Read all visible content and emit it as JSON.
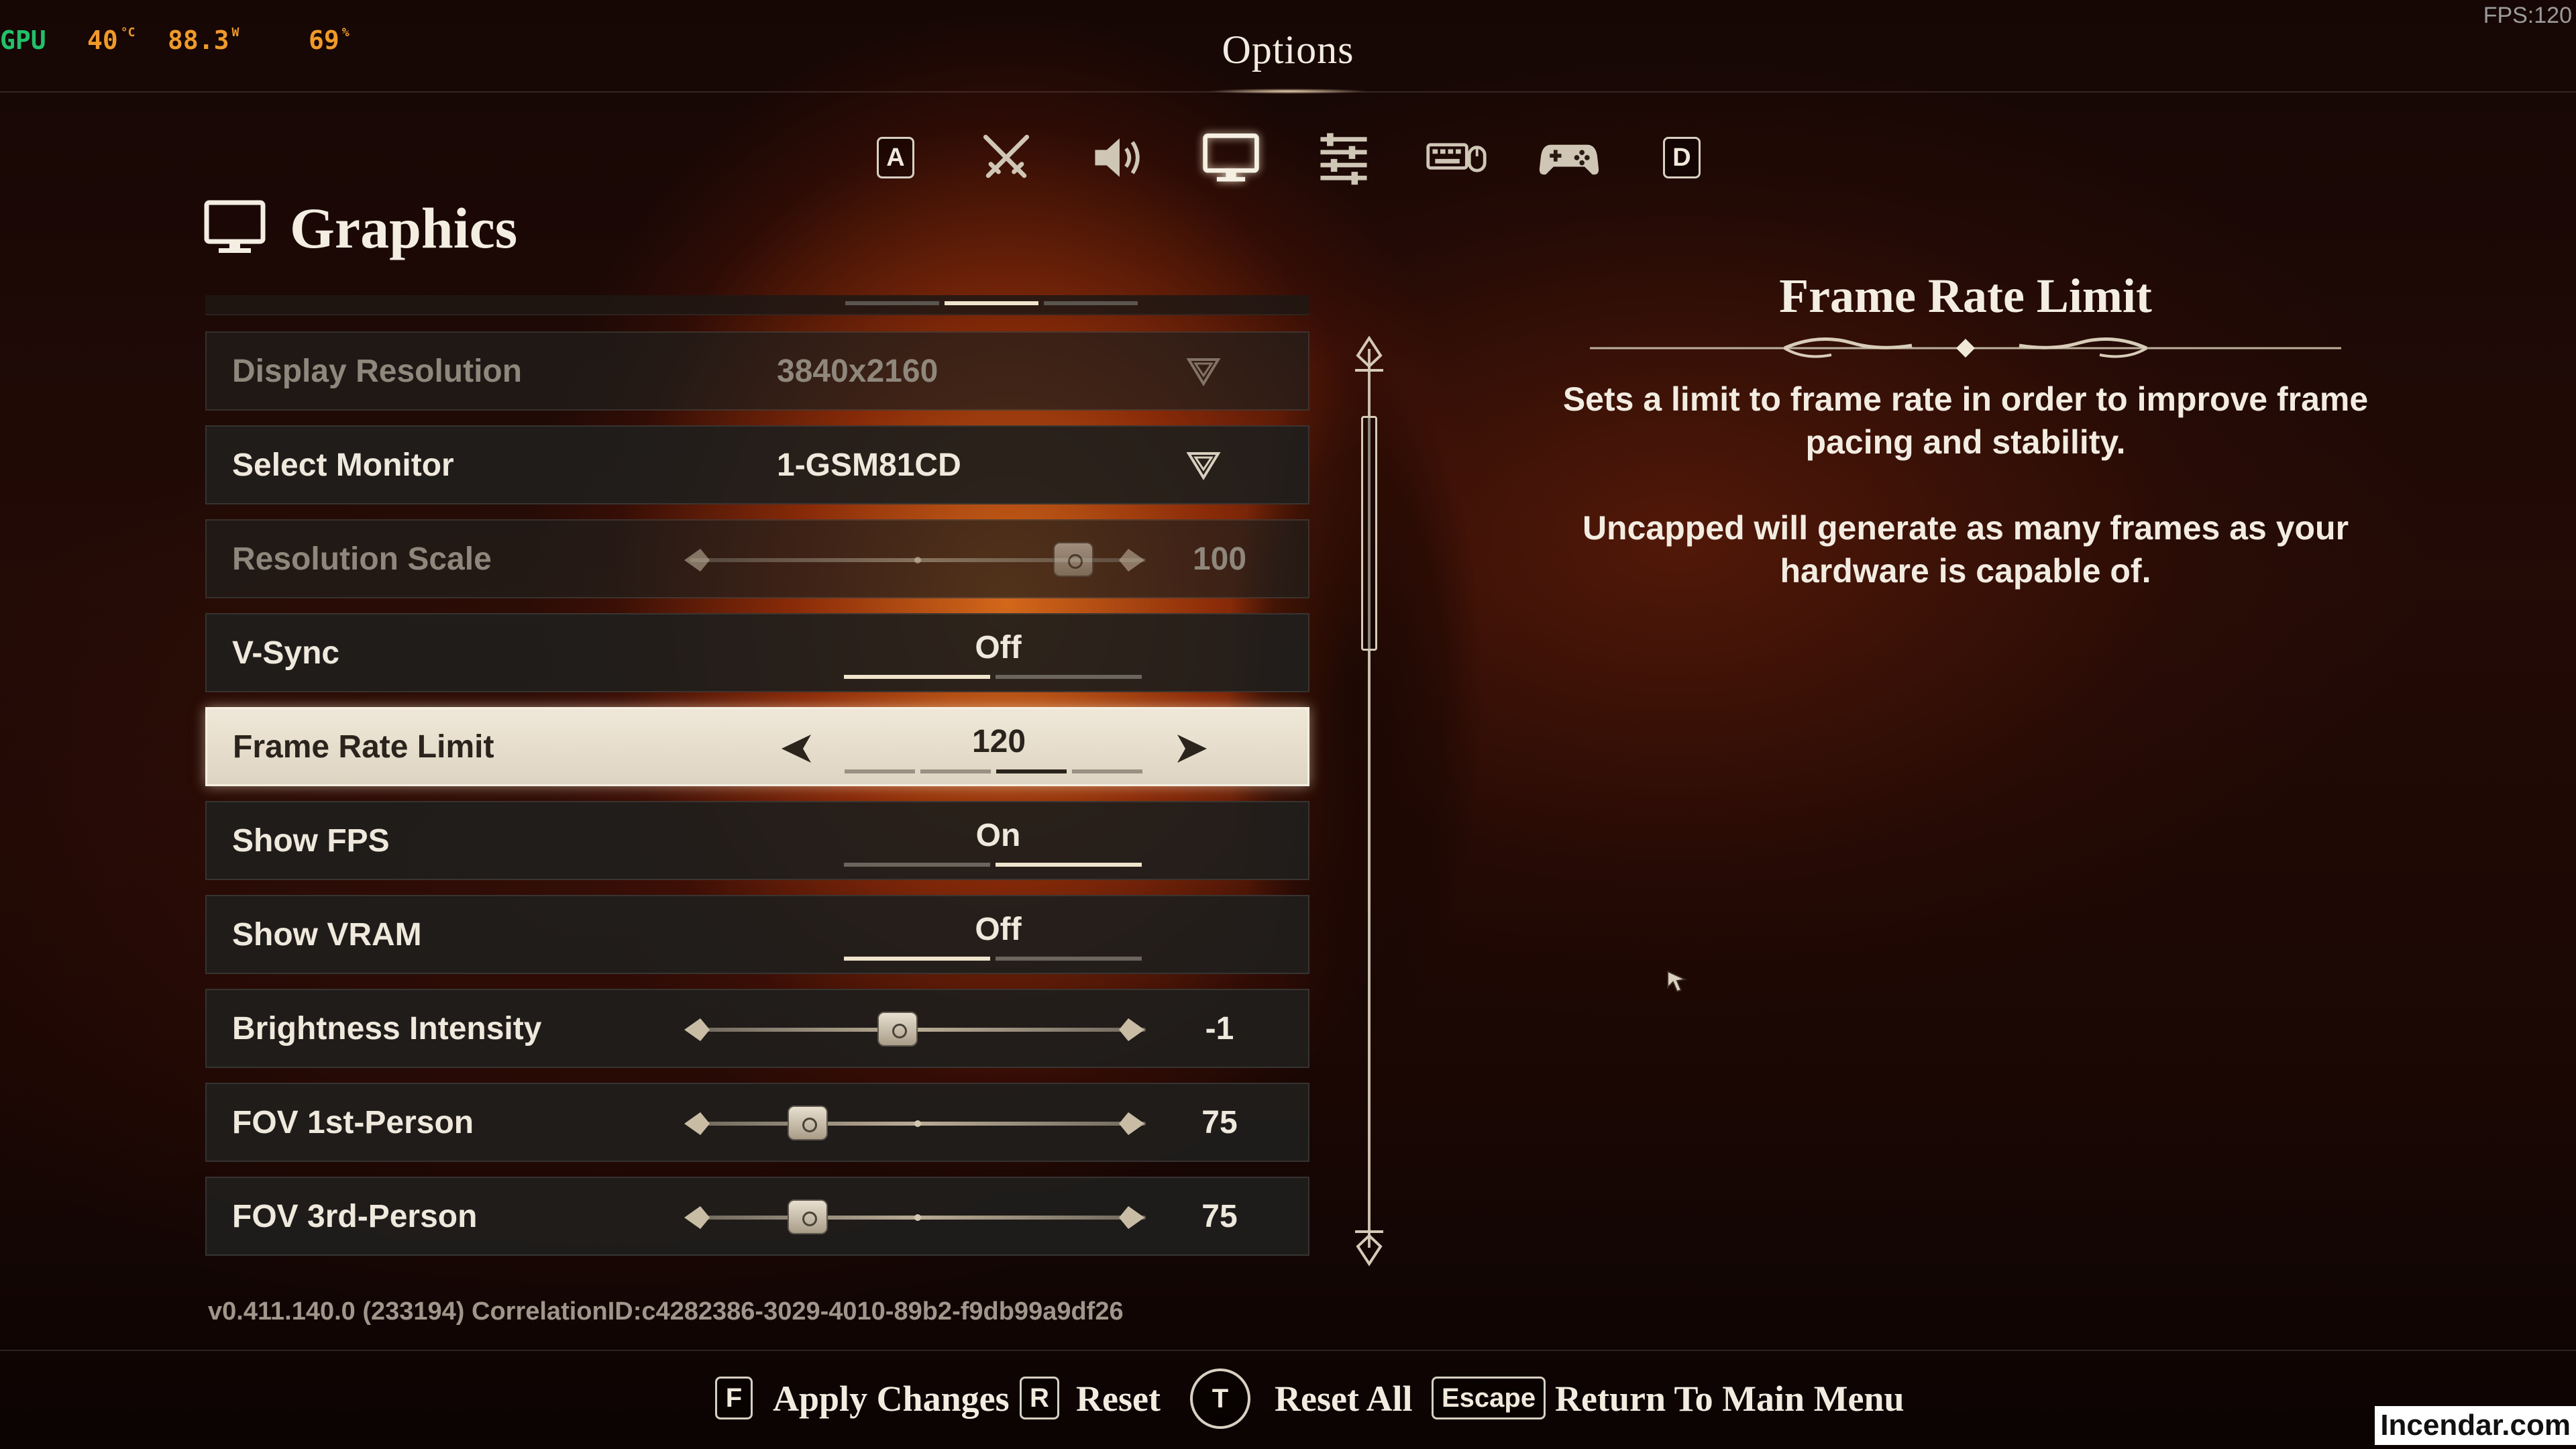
{
  "hud": {
    "gpu_label": "GPU",
    "temp": "40",
    "temp_unit": "°C",
    "power": "88.3",
    "power_unit": "W",
    "usage": "69",
    "usage_unit": "%",
    "fps": "FPS:120"
  },
  "header": {
    "title": "Options"
  },
  "tabs": [
    {
      "label": "A",
      "icon": "keycap-a-icon",
      "kind": "key"
    },
    {
      "label": "",
      "icon": "crossed-swords-icon",
      "kind": "icon"
    },
    {
      "label": "",
      "icon": "speaker-icon",
      "kind": "icon"
    },
    {
      "label": "",
      "icon": "monitor-icon",
      "kind": "icon",
      "active": true
    },
    {
      "label": "",
      "icon": "sliders-icon",
      "kind": "icon"
    },
    {
      "label": "",
      "icon": "keyboard-mouse-icon",
      "kind": "icon"
    },
    {
      "label": "",
      "icon": "gamepad-icon",
      "kind": "icon"
    },
    {
      "label": "D",
      "icon": "keycap-d-icon",
      "kind": "key"
    }
  ],
  "section": {
    "title": "Graphics",
    "icon": "monitor-icon"
  },
  "pagination": {
    "pages": 3,
    "current": 2
  },
  "settings": [
    {
      "label": "Display Resolution",
      "type": "dropdown",
      "value": "3840x2160",
      "disabled": true
    },
    {
      "label": "Select Monitor",
      "type": "dropdown",
      "value": "1-GSM81CD"
    },
    {
      "label": "Resolution Scale",
      "type": "slider",
      "value": "100",
      "level": 1.0,
      "disabled": true
    },
    {
      "label": "V-Sync",
      "type": "toggle",
      "value": "Off",
      "segments": 2,
      "active_segment": 1
    },
    {
      "label": "Frame Rate Limit",
      "type": "selector",
      "value": "120",
      "segments": 4,
      "active_segment": 3,
      "selected": true
    },
    {
      "label": "Show FPS",
      "type": "toggle",
      "value": "On",
      "segments": 2,
      "active_segment": 2
    },
    {
      "label": "Show VRAM",
      "type": "toggle",
      "value": "Off",
      "segments": 2,
      "active_segment": 1
    },
    {
      "label": "Brightness Intensity",
      "type": "slider",
      "value": "-1",
      "level": 0.45
    },
    {
      "label": "FOV 1st-Person",
      "type": "slider",
      "value": "75",
      "level": 0.25
    },
    {
      "label": "FOV 3rd-Person",
      "type": "slider",
      "value": "75",
      "level": 0.25
    }
  ],
  "description": {
    "title": "Frame Rate Limit",
    "text1": "Sets a limit to frame rate in order to improve frame pacing and stability.",
    "text2": "Uncapped will generate as many frames as your hardware is capable of."
  },
  "version": "v0.411.140.0 (233194) CorrelationID:c4282386-3029-4010-89b2-f9db99a9df26",
  "footer": {
    "apply_key": "F",
    "apply_label": "Apply Changes",
    "reset_key": "R",
    "reset_label": "Reset",
    "reset_all_key": "T",
    "reset_all_label": "Reset All",
    "return_key": "Escape",
    "return_label": "Return To Main Menu"
  },
  "watermark": "Incendar.com",
  "colors": {
    "accent": "#efe4cc",
    "hud_green": "#22c06a",
    "hud_orange": "#f09a2a",
    "row_bg": "#201e1c",
    "selected_bg": "#e8dfcf"
  }
}
